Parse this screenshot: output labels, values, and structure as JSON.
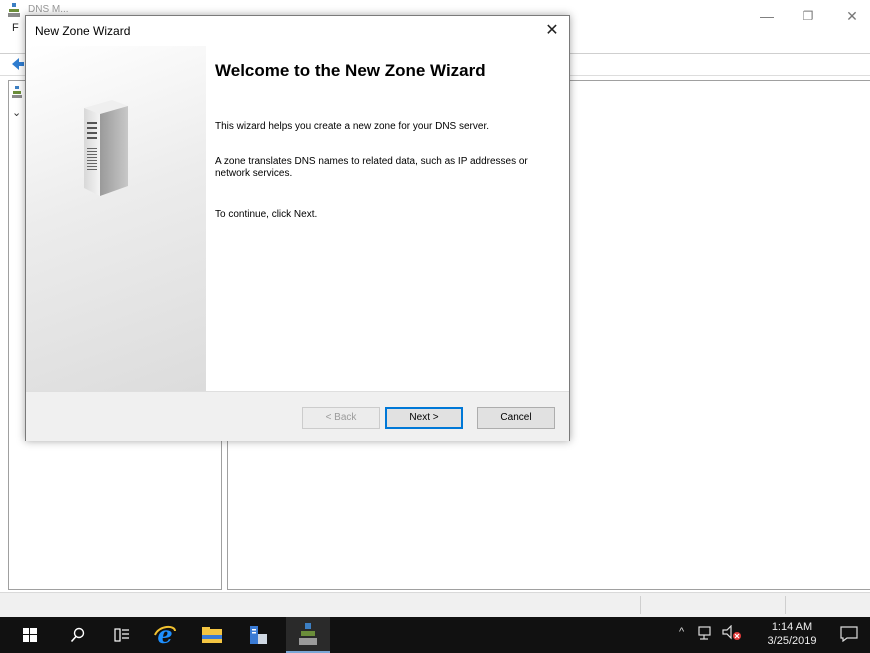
{
  "background_window": {
    "title": "DNS M...",
    "menu_letter": "F",
    "controls": {
      "minimize": "—",
      "maximize": "❐",
      "close": "✕"
    }
  },
  "wizard": {
    "title": "New Zone Wizard",
    "close_glyph": "✕",
    "heading": "Welcome to the New Zone Wizard",
    "paragraph1": "This wizard helps you create a new zone for your DNS server.",
    "paragraph2": "A zone translates DNS names to related data, such as IP addresses or network services.",
    "paragraph3": "To continue, click Next.",
    "buttons": {
      "back": "< Back",
      "next": "Next >",
      "cancel": "Cancel"
    }
  },
  "taskbar": {
    "time": "1:14 AM",
    "date": "3/25/2019",
    "tray_up": "^"
  },
  "colors": {
    "accent": "#0078d7",
    "taskbar": "#111111"
  }
}
